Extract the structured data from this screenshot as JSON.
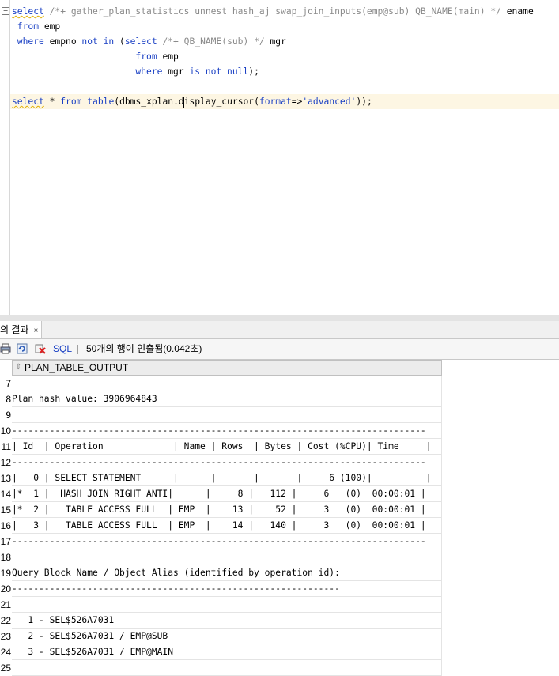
{
  "editor": {
    "fold_symbol": "−",
    "lines": [
      [
        {
          "t": "select",
          "c": "kw sq"
        },
        {
          "t": " /*+ gather_plan_statistics unnest hash_aj swap_join_inputs(emp@sub) QB_NAME(main) */ ",
          "c": "cm"
        },
        {
          "t": "ename",
          "c": ""
        }
      ],
      [
        {
          "t": " from",
          "c": "kw"
        },
        {
          "t": " emp",
          "c": ""
        }
      ],
      [
        {
          "t": " where",
          "c": "kw"
        },
        {
          "t": " empno ",
          "c": ""
        },
        {
          "t": "not in",
          "c": "kw"
        },
        {
          "t": " (",
          "c": ""
        },
        {
          "t": "select",
          "c": "kw"
        },
        {
          "t": " /*+ QB_NAME(sub) */ ",
          "c": "cm"
        },
        {
          "t": "mgr",
          "c": ""
        }
      ],
      [
        {
          "t": "                       from",
          "c": "kw"
        },
        {
          "t": " emp",
          "c": ""
        }
      ],
      [
        {
          "t": "                       where",
          "c": "kw"
        },
        {
          "t": " mgr ",
          "c": ""
        },
        {
          "t": "is not null",
          "c": "kw"
        },
        {
          "t": ");",
          "c": ""
        }
      ],
      [],
      [
        {
          "t": "select",
          "c": "kw sq"
        },
        {
          "t": " * ",
          "c": ""
        },
        {
          "t": "from",
          "c": "kw"
        },
        {
          "t": " ",
          "c": ""
        },
        {
          "t": "table",
          "c": "kw"
        },
        {
          "t": "(dbms_xplan.d",
          "c": ""
        },
        {
          "t": "",
          "c": "caret"
        },
        {
          "t": "isplay_cursor(",
          "c": ""
        },
        {
          "t": "format",
          "c": "kw"
        },
        {
          "t": "=>",
          "c": ""
        },
        {
          "t": "'advanced'",
          "c": "st"
        },
        {
          "t": "));",
          "c": ""
        }
      ]
    ]
  },
  "results_tab": {
    "label": "의 결과",
    "close": "×"
  },
  "toolbar": {
    "sql_label": "SQL",
    "status": "50개의 행이 인출됨(0.042초)"
  },
  "grid": {
    "column_header": "PLAN_TABLE_OUTPUT",
    "sort_icon": "⇕",
    "rows": [
      {
        "num": "7",
        "text": ""
      },
      {
        "num": "8",
        "text": "Plan hash value: 3906964843"
      },
      {
        "num": "9",
        "text": ""
      },
      {
        "num": "10",
        "text": "-----------------------------------------------------------------------------"
      },
      {
        "num": "11",
        "text": "| Id  | Operation             | Name | Rows  | Bytes | Cost (%CPU)| Time     |"
      },
      {
        "num": "12",
        "text": "-----------------------------------------------------------------------------"
      },
      {
        "num": "13",
        "text": "|   0 | SELECT STATEMENT      |      |       |       |     6 (100)|          |"
      },
      {
        "num": "14",
        "text": "|*  1 |  HASH JOIN RIGHT ANTI|      |     8 |   112 |     6   (0)| 00:00:01 |"
      },
      {
        "num": "15",
        "text": "|*  2 |   TABLE ACCESS FULL  | EMP  |    13 |    52 |     3   (0)| 00:00:01 |"
      },
      {
        "num": "16",
        "text": "|   3 |   TABLE ACCESS FULL  | EMP  |    14 |   140 |     3   (0)| 00:00:01 |"
      },
      {
        "num": "17",
        "text": "-----------------------------------------------------------------------------"
      },
      {
        "num": "18",
        "text": ""
      },
      {
        "num": "19",
        "text": "Query Block Name / Object Alias (identified by operation id):"
      },
      {
        "num": "20",
        "text": "-------------------------------------------------------------"
      },
      {
        "num": "21",
        "text": ""
      },
      {
        "num": "22",
        "text": "   1 - SEL$526A7031"
      },
      {
        "num": "23",
        "text": "   2 - SEL$526A7031 / EMP@SUB"
      },
      {
        "num": "24",
        "text": "   3 - SEL$526A7031 / EMP@MAIN"
      },
      {
        "num": "25",
        "text": ""
      }
    ]
  }
}
